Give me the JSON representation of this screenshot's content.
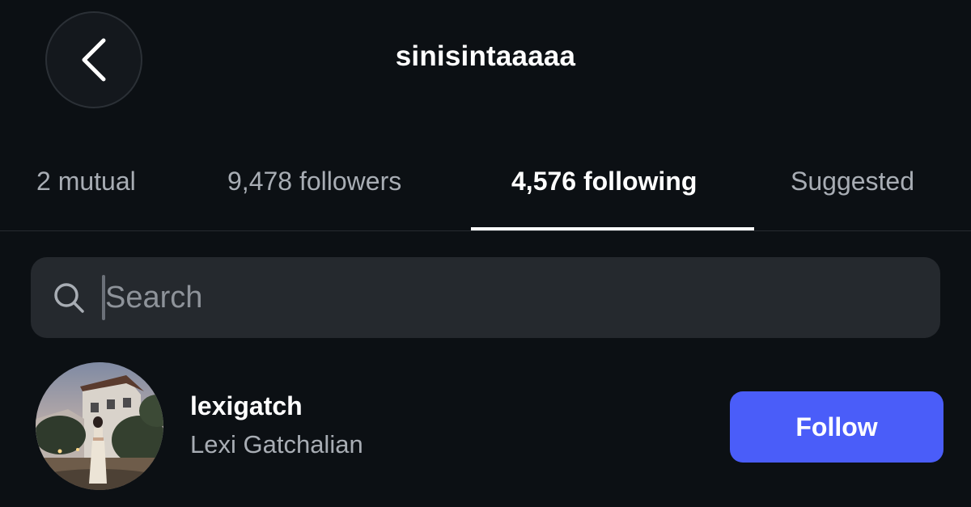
{
  "header": {
    "title": "sinisintaaaaa",
    "back_icon": "chevron-left-icon"
  },
  "tabs": [
    {
      "label": "2 mutual",
      "active": false
    },
    {
      "label": "9,478 followers",
      "active": false
    },
    {
      "label": "4,576 following",
      "active": true
    },
    {
      "label": "Suggested",
      "active": false
    }
  ],
  "search": {
    "placeholder": "Search",
    "value": "",
    "icon": "search-icon"
  },
  "users": [
    {
      "username": "lexigatch",
      "full_name": "Lexi Gatchalian",
      "follow_label": "Follow"
    }
  ],
  "colors": {
    "background": "#0c1014",
    "accent": "#4a5df9",
    "search_bg": "#25292e",
    "secondary_text": "#a8adb4"
  }
}
